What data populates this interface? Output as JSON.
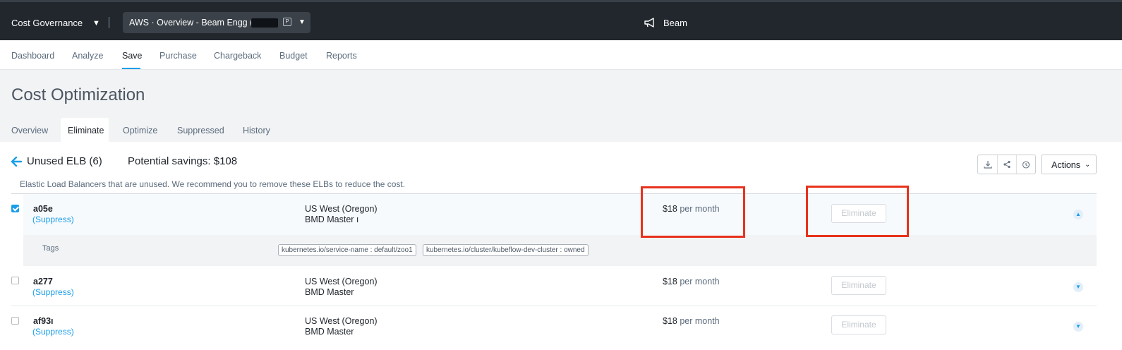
{
  "topbar": {
    "app_name": "Cost Governance",
    "account_selector": "AWS  ·  Overview - Beam Engg (",
    "account_badge": "P",
    "product": "Beam"
  },
  "main_nav": {
    "items": [
      {
        "label": "Dashboard"
      },
      {
        "label": "Analyze"
      },
      {
        "label": "Save",
        "active": true
      },
      {
        "label": "Purchase"
      },
      {
        "label": "Chargeback"
      },
      {
        "label": "Budget"
      },
      {
        "label": "Reports"
      }
    ]
  },
  "page": {
    "title": "Cost Optimization",
    "tabs": [
      {
        "label": "Overview"
      },
      {
        "label": "Eliminate",
        "active": true
      },
      {
        "label": "Optimize"
      },
      {
        "label": "Suppressed"
      },
      {
        "label": "History"
      }
    ]
  },
  "section": {
    "title": "Unused ELB (6)",
    "savings": "Potential savings: $108",
    "description": "Elastic Load Balancers that are unused. We recommend you to remove these ELBs to reduce the cost.",
    "actions_label": "Actions",
    "toolbar_icons": [
      "download-icon",
      "share-icon",
      "clock-icon"
    ]
  },
  "rows": [
    {
      "name": "a05e",
      "suppress": "(Suppress)",
      "region": "US West (Oregon)",
      "account": "BMD Master ı",
      "cost": "$18",
      "cost_unit": "per month",
      "eliminate": "Eliminate",
      "checked": true,
      "expanded": true
    },
    {
      "name": "a277",
      "suppress": "(Suppress)",
      "region": "US West (Oregon)",
      "account": "BMD Master",
      "cost": "$18",
      "cost_unit": "per month",
      "eliminate": "Eliminate",
      "checked": false,
      "expanded": false
    },
    {
      "name": "af93ı",
      "suppress": "(Suppress)",
      "region": "US West (Oregon)",
      "account": "BMD Master",
      "cost": "$18",
      "cost_unit": "per month",
      "eliminate": "Eliminate",
      "checked": false,
      "expanded": false
    }
  ],
  "tags": {
    "label": "Tags",
    "items": [
      "kubernetes.io/service-name : default/zoo1",
      "kubernetes.io/cluster/kubeflow-dev-cluster : owned"
    ]
  },
  "colors": {
    "accent": "#1b9ee8",
    "topbar": "#22272e",
    "highlight": "#e8321c"
  }
}
